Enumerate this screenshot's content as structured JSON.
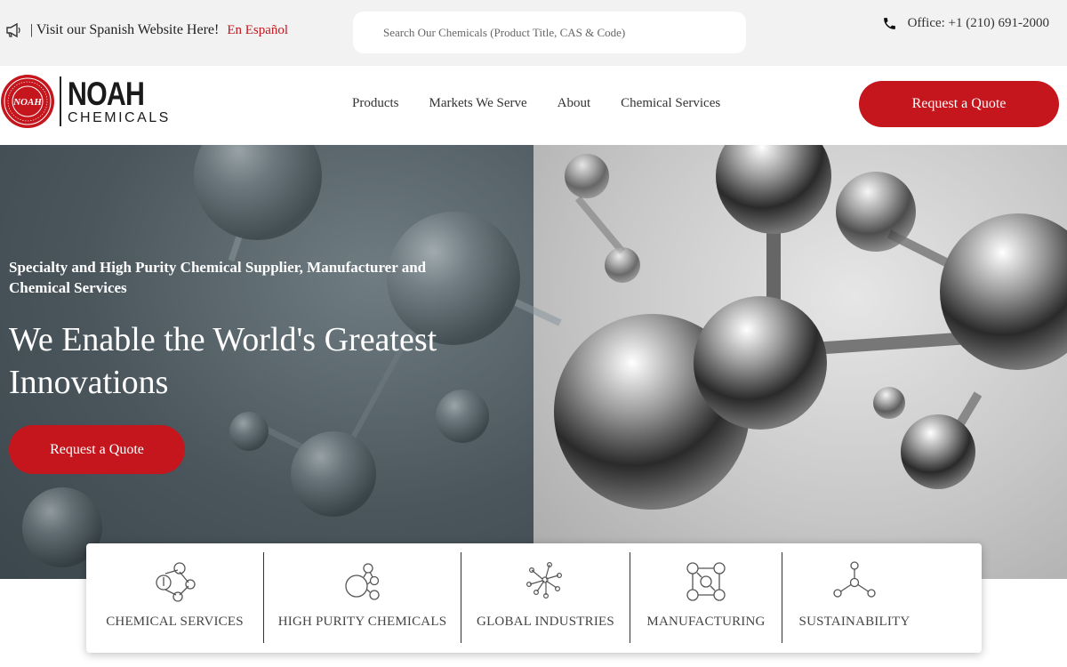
{
  "topbar": {
    "announcement": "| Visit our Spanish Website Here!",
    "language_link": "En Español",
    "search_placeholder": "Search Our Chemicals (Product Title, CAS & Code)",
    "office_phone": "Office: +1 (210) 691-2000"
  },
  "header": {
    "logo": {
      "name": "NOAH",
      "subname": "CHEMICALS",
      "seal_text": "NOAH"
    },
    "nav": [
      "Products",
      "Markets We Serve",
      "About",
      "Chemical Services"
    ],
    "quote_button": "Request a Quote"
  },
  "hero": {
    "subtitle": "Specialty and High Purity Chemical Supplier, Manufacturer and Chemical Services",
    "title": "We Enable the World's Greatest Innovations",
    "button": "Request a Quote"
  },
  "services": [
    {
      "label": "CHEMICAL SERVICES",
      "icon": "molecule-ring-icon"
    },
    {
      "label": "HIGH PURITY CHEMICALS",
      "icon": "molecule-cluster-icon"
    },
    {
      "label": "GLOBAL INDUSTRIES",
      "icon": "molecule-network-icon"
    },
    {
      "label": "MANUFACTURING",
      "icon": "molecule-grid-icon"
    },
    {
      "label": "SUSTAINABILITY",
      "icon": "molecule-tripod-icon"
    }
  ],
  "colors": {
    "accent": "#c4161c",
    "topbar_bg": "#f2f2f2",
    "hero_left": "#4a565c"
  }
}
